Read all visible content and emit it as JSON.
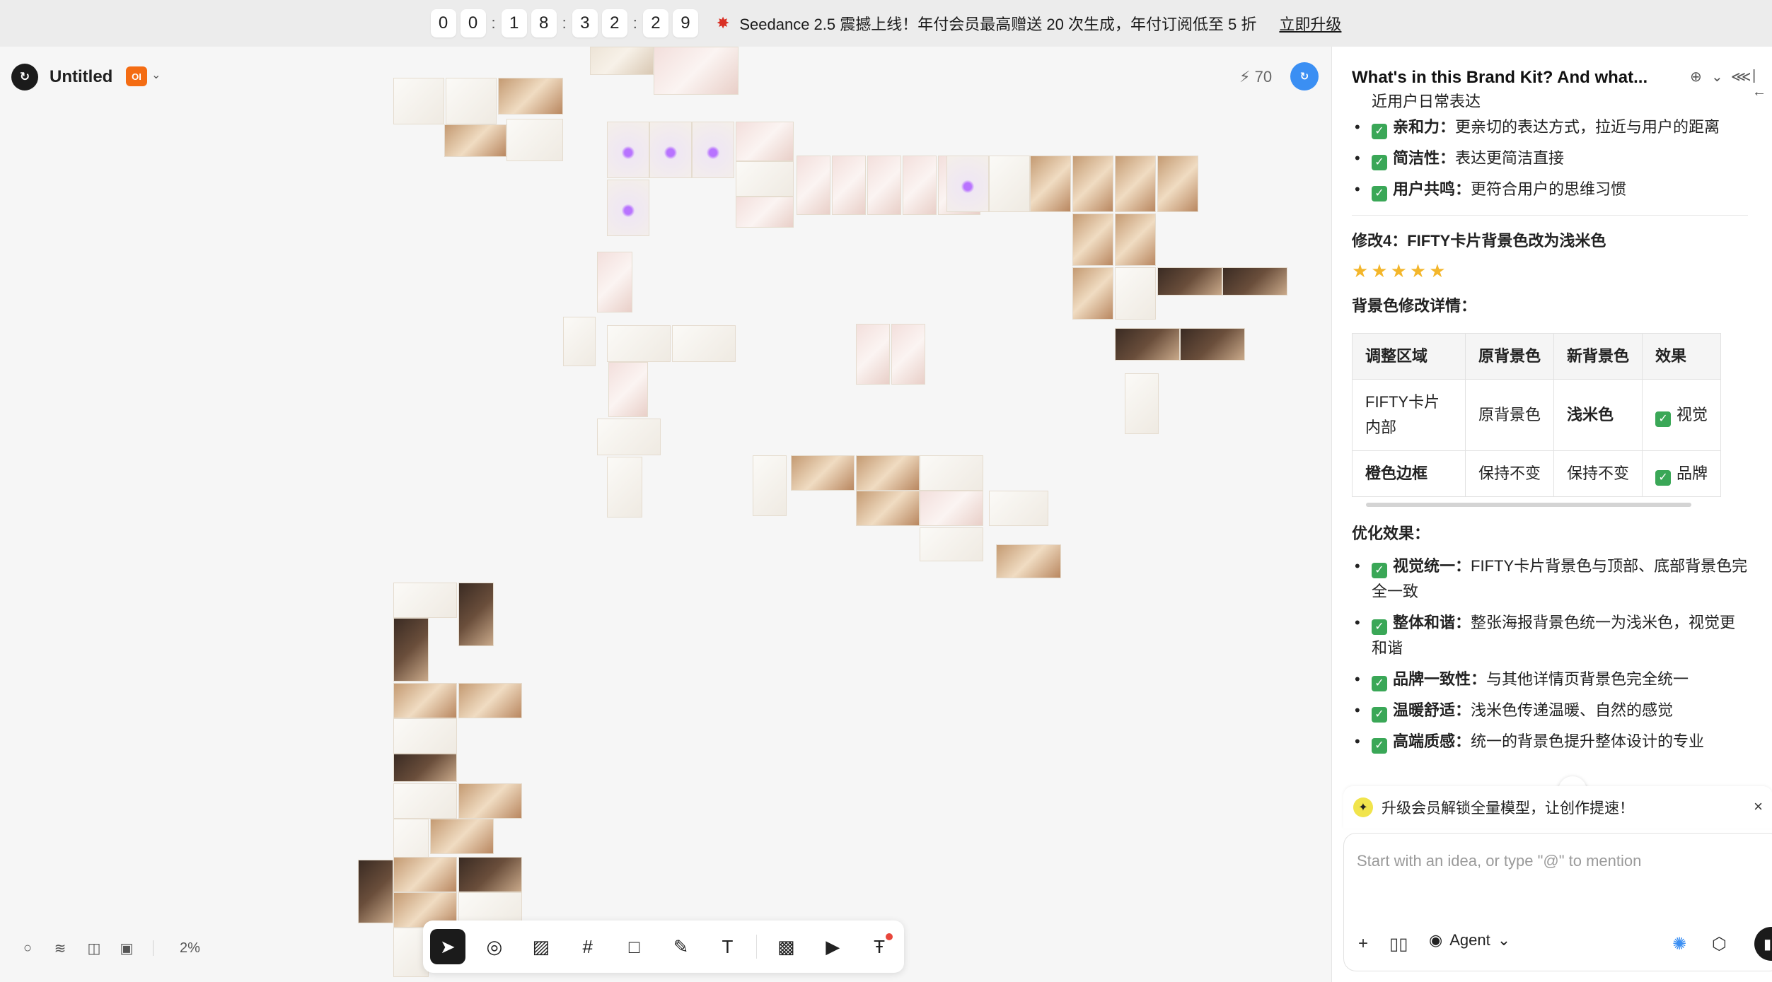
{
  "banner": {
    "digits": [
      "0",
      "0",
      "1",
      "8",
      "3",
      "2",
      "2",
      "9"
    ],
    "message": "Seedance 2.5 震撼上线！年付会员最高赠送 20 次生成，年付订阅低至 5 折",
    "link": "立即升级"
  },
  "header": {
    "title": "Untitled",
    "badge": "OI",
    "credits": "70"
  },
  "canvas": {
    "zoom": "2%"
  },
  "toolbar": {
    "tools": [
      "select",
      "pin",
      "image-edit",
      "frame",
      "rectangle",
      "pen",
      "text",
      "ai-image",
      "ai-video",
      "ai-text"
    ]
  },
  "panel": {
    "title": "What's in this Brand Kit? And what...",
    "top_fragment": "近用户日常表达",
    "list1": [
      {
        "bold": "亲和力：",
        "text": "更亲切的表达方式，拉近与用户的距离"
      },
      {
        "bold": "简洁性：",
        "text": "表达更简洁直接"
      },
      {
        "bold": "用户共鸣：",
        "text": "更符合用户的思维习惯"
      }
    ],
    "section_title": "修改4：FIFTY卡片背景色改为浅米色",
    "stars": "★★★★★",
    "detail_title": "背景色修改详情：",
    "table": {
      "headers": [
        "调整区域",
        "原背景色",
        "新背景色",
        "效果"
      ],
      "rows": [
        {
          "area": "FIFTY卡片内部",
          "orig": "原背景色",
          "new": "浅米色",
          "effect": "视觉"
        },
        {
          "area": "橙色边框",
          "orig": "保持不变",
          "new": "保持不变",
          "effect": "品牌"
        }
      ]
    },
    "effect_title": "优化效果：",
    "list2": [
      {
        "bold": "视觉统一：",
        "text": "FIFTY卡片背景色与顶部、底部背景色完全一致"
      },
      {
        "bold": "整体和谐：",
        "text": "整张海报背景色统一为浅米色，视觉更和谐"
      },
      {
        "bold": "品牌一致性：",
        "text": "与其他详情页背景色完全统一"
      },
      {
        "bold": "温暖舒适：",
        "text": "浅米色传递温暖、自然的感觉"
      },
      {
        "bold": "高端质感：",
        "text": "统一的背景色提升整体设计的专业"
      }
    ],
    "upgrade_text": "升级会员解锁全量模型，让创作提速！",
    "composer_placeholder": "Start with an idea, or type \"@\" to mention",
    "agent_label": "Agent"
  },
  "icons": {
    "logo": "logo-icon",
    "bolt": "bolt-icon",
    "close": "close-icon"
  }
}
